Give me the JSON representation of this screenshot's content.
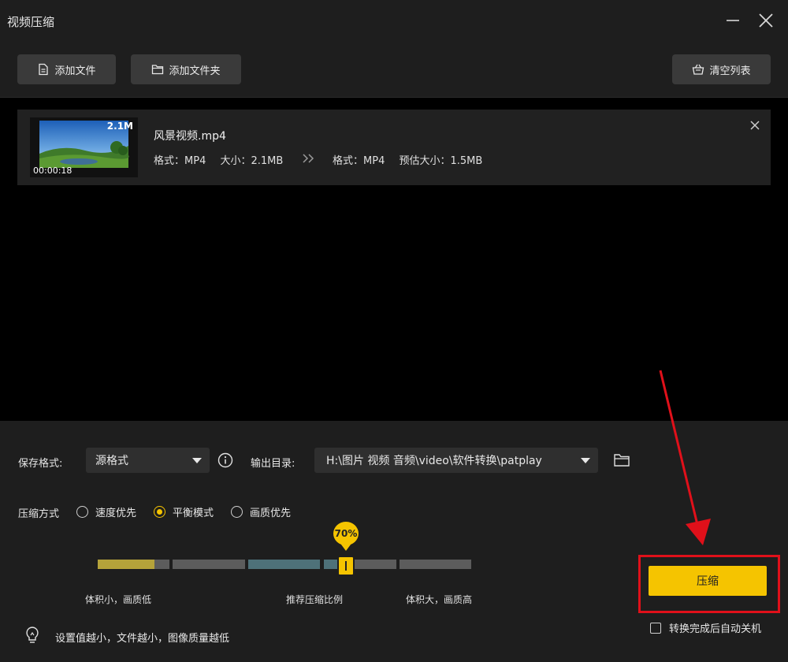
{
  "window": {
    "title": "视频压缩"
  },
  "toolbar": {
    "add_file": "添加文件",
    "add_folder": "添加文件夹",
    "clear_list": "清空列表"
  },
  "file": {
    "thumb_size": "2.1M",
    "duration": "00:00:18",
    "name": "风景视频.mp4",
    "src_format_label": "格式：",
    "src_format": "MP4",
    "src_size_label": "大小：",
    "src_size": "2.1MB",
    "dst_format_label": "格式：",
    "dst_format": "MP4",
    "est_size_label": "预估大小：",
    "est_size": "1.5MB"
  },
  "settings": {
    "save_format_label": "保存格式:",
    "save_format_value": "源格式",
    "output_dir_label": "输出目录:",
    "output_dir_value": "H:\\图片 视频 音频\\video\\软件转换\\patplay",
    "method_label": "压缩方式",
    "methods": [
      {
        "label": "速度优先",
        "selected": false
      },
      {
        "label": "平衡模式",
        "selected": true
      },
      {
        "label": "画质优先",
        "selected": false
      }
    ]
  },
  "slider": {
    "value_percent": 70,
    "value_label": "70%",
    "left_label": "体积小，画质低",
    "mid_label": "推荐压缩比例",
    "right_label": "体积大，画质高"
  },
  "tip": {
    "text": "设置值越小，文件越小，图像质量越低"
  },
  "action": {
    "compress_label": "压缩",
    "auto_shutdown_label": "转换完成后自动关机",
    "auto_shutdown_checked": false
  },
  "colors": {
    "accent": "#f5c400",
    "annotation": "#e0101a"
  },
  "icons": [
    "minimize-icon",
    "close-icon",
    "file-icon",
    "folder-icon",
    "basket-icon",
    "info-icon",
    "bulb-icon",
    "double-chevron-icon"
  ]
}
